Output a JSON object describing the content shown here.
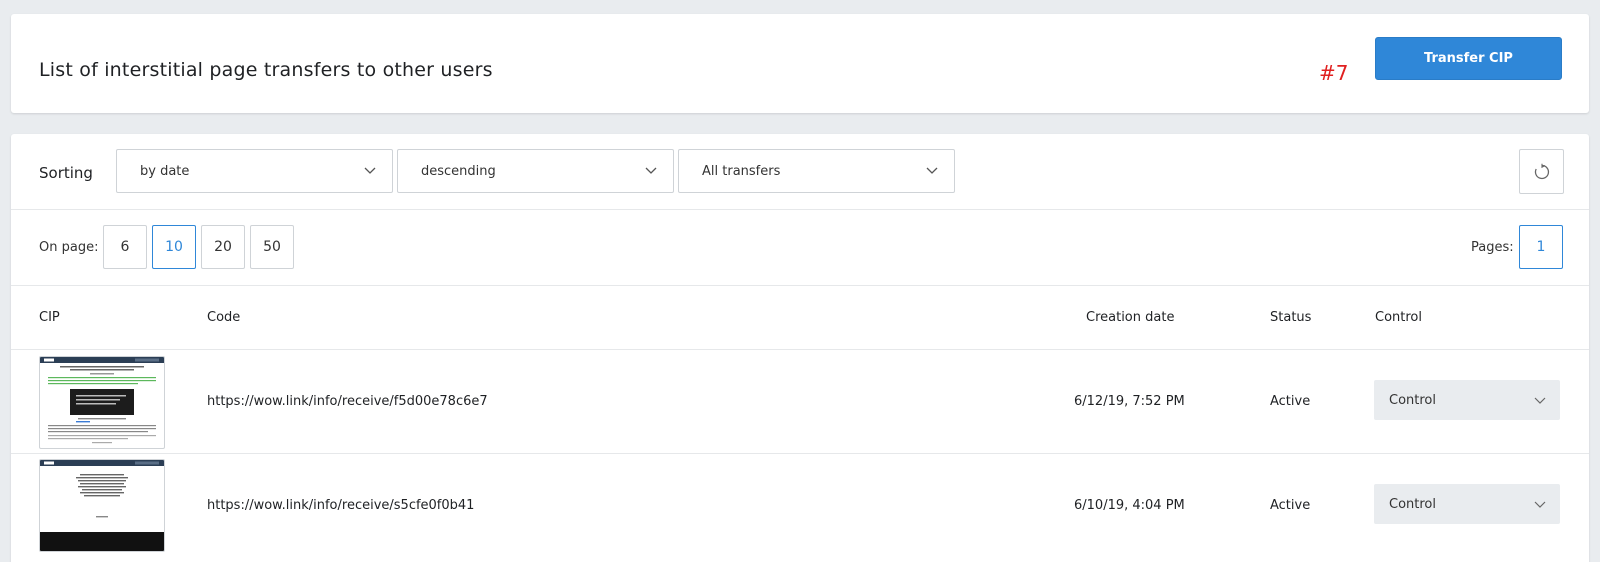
{
  "header": {
    "title": "List of interstitial page transfers to other users",
    "annotation": "#7",
    "transfer_button": "Transfer CIP"
  },
  "toolbar": {
    "sorting_label": "Sorting",
    "sort_by": "by date",
    "sort_order": "descending",
    "filter": "All transfers",
    "refresh_icon": "refresh-icon"
  },
  "pagination": {
    "on_page_label": "On page:",
    "page_sizes": [
      "6",
      "10",
      "20",
      "50"
    ],
    "selected_page_size": "10",
    "pages_label": "Pages:",
    "current_page": "1"
  },
  "table": {
    "columns": {
      "cip": "CIP",
      "code": "Code",
      "creation_date": "Creation date",
      "status": "Status",
      "control": "Control"
    },
    "rows": [
      {
        "code": "https://wow.link/info/receive/f5d00e78c6e7",
        "creation_date": "6/12/19, 7:52 PM",
        "status": "Active",
        "control": "Control"
      },
      {
        "code": "https://wow.link/info/receive/s5cfe0f0b41",
        "creation_date": "6/10/19, 4:04 PM",
        "status": "Active",
        "control": "Control"
      }
    ]
  },
  "colors": {
    "accent": "#2f87d8",
    "annotation": "#e02020",
    "background": "#e9ecef"
  }
}
